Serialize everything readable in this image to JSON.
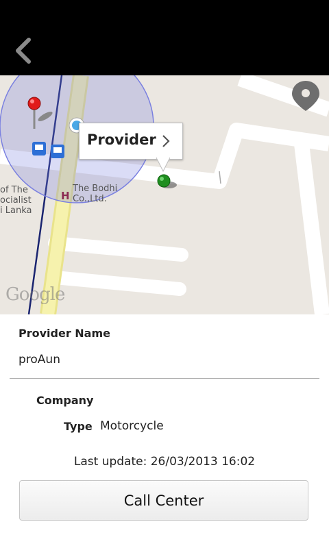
{
  "header": {
    "back_icon": "chevron-left-icon"
  },
  "map": {
    "callout_title": "Provider",
    "place_label_line1": "The Bodhi",
    "place_label_line2": "Co.,Ltd.",
    "left_label_line1": "of The",
    "left_label_line2": "ocialist",
    "left_label_line3": "i Lanka",
    "hotel_marker": "H",
    "attribution": "Google",
    "my_location_icon": "location-pin-icon",
    "accuracy_circle_color": "#7a80e0",
    "road_color": "#f2ee9e"
  },
  "details": {
    "provider_name_label": "Provider Name",
    "provider_name_value": "proAun",
    "company_label": "Company",
    "type_label": "Type",
    "type_value": "Motorcycle",
    "last_update": "Last update: 26/03/2013 16:02",
    "call_center_label": "Call Center"
  }
}
